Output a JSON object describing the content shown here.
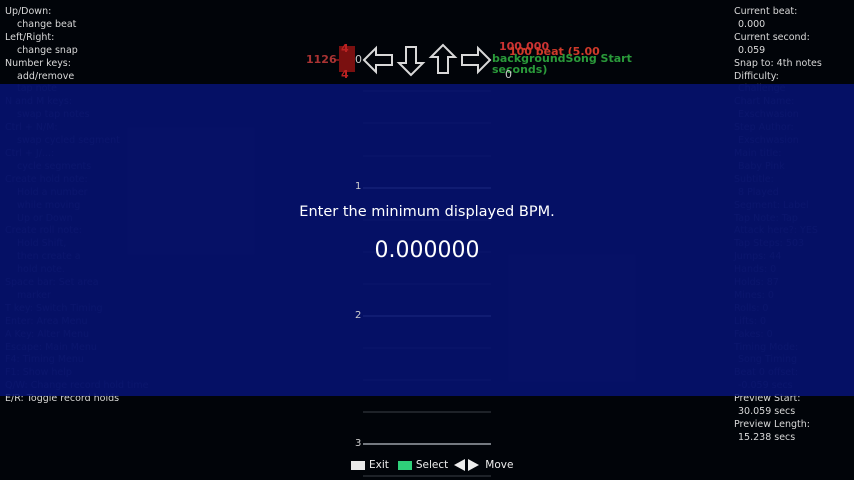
{
  "help_lines": [
    {
      "text": "Up/Down:",
      "indent": false,
      "dim": false
    },
    {
      "text": "change beat",
      "indent": true,
      "dim": false
    },
    {
      "text": "Left/Right:",
      "indent": false,
      "dim": false
    },
    {
      "text": "change snap",
      "indent": true,
      "dim": false
    },
    {
      "text": "Number keys:",
      "indent": false,
      "dim": false
    },
    {
      "text": "add/remove",
      "indent": true,
      "dim": false
    },
    {
      "text": "tap note",
      "indent": true,
      "dim": true
    },
    {
      "text": "N and M keys:",
      "indent": false,
      "dim": true
    },
    {
      "text": "swap tap notes",
      "indent": true,
      "dim": true
    },
    {
      "text": "Ctrl + N/M:",
      "indent": false,
      "dim": true
    },
    {
      "text": "swap cycled segment",
      "indent": true,
      "dim": true
    },
    {
      "text": "Ctrl + J/...:",
      "indent": false,
      "dim": true
    },
    {
      "text": "cycle segments",
      "indent": true,
      "dim": true
    },
    {
      "text": "Create hold note:",
      "indent": false,
      "dim": true
    },
    {
      "text": "Hold a number",
      "indent": true,
      "dim": true
    },
    {
      "text": "while moving",
      "indent": true,
      "dim": true
    },
    {
      "text": "Up or Down",
      "indent": true,
      "dim": true
    },
    {
      "text": "Create roll note:",
      "indent": false,
      "dim": true
    },
    {
      "text": "Hold Shift,",
      "indent": true,
      "dim": true
    },
    {
      "text": "then create a",
      "indent": true,
      "dim": true
    },
    {
      "text": "hold note.",
      "indent": true,
      "dim": true
    },
    {
      "text": "Space bar: Set area",
      "indent": false,
      "dim": true
    },
    {
      "text": "marker",
      "indent": true,
      "dim": true
    },
    {
      "text": "T key: Switch Timing",
      "indent": false,
      "dim": true
    },
    {
      "text": "Enter: Area Menu",
      "indent": false,
      "dim": true
    },
    {
      "text": "A Key: Alter Menu",
      "indent": false,
      "dim": true
    },
    {
      "text": "Escape: Main Menu",
      "indent": false,
      "dim": true
    },
    {
      "text": "F4: Timing Menu",
      "indent": false,
      "dim": true
    },
    {
      "text": "F1: Show help",
      "indent": false,
      "dim": true
    },
    {
      "text": "Q/W: Change record hold time",
      "indent": false,
      "dim": true
    },
    {
      "text": "E/R: Toggle record holds",
      "indent": false,
      "dim": false
    }
  ],
  "info_lines": [
    {
      "text": "Current beat:",
      "indent": false,
      "dim": false
    },
    {
      "text": "0.000",
      "indent": true,
      "dim": false
    },
    {
      "text": "Current second:",
      "indent": false,
      "dim": false
    },
    {
      "text": "0.059",
      "indent": true,
      "dim": false
    },
    {
      "text": "Snap to: 4th notes",
      "indent": false,
      "dim": false
    },
    {
      "text": "Difficulty:",
      "indent": false,
      "dim": false
    },
    {
      "text": "Challenge",
      "indent": true,
      "dim": true
    },
    {
      "text": "Chart Name:",
      "indent": false,
      "dim": true
    },
    {
      "text": "Exschwasion",
      "indent": true,
      "dim": true
    },
    {
      "text": "Step Author:",
      "indent": false,
      "dim": true
    },
    {
      "text": "Exschwasion",
      "indent": true,
      "dim": true
    },
    {
      "text": "Main title:",
      "indent": false,
      "dim": true
    },
    {
      "text": "Baby Pink",
      "indent": true,
      "dim": true
    },
    {
      "text": "Subtitle:",
      "indent": false,
      "dim": true
    },
    {
      "text": "8 Played",
      "indent": true,
      "dim": true
    },
    {
      "text": "Segment: Label",
      "indent": false,
      "dim": true
    },
    {
      "text": "Tap Note: Tap",
      "indent": false,
      "dim": true
    },
    {
      "text": "Attack here?: YES",
      "indent": false,
      "dim": true
    },
    {
      "text": "Tap Steps: 503",
      "indent": false,
      "dim": true
    },
    {
      "text": "Jumps: 44",
      "indent": false,
      "dim": true
    },
    {
      "text": "Hands: 0",
      "indent": false,
      "dim": true
    },
    {
      "text": "Holds: 87",
      "indent": false,
      "dim": true
    },
    {
      "text": "Mines: 0",
      "indent": false,
      "dim": true
    },
    {
      "text": "Rolls: 0",
      "indent": false,
      "dim": true
    },
    {
      "text": "Lifts: 0",
      "indent": false,
      "dim": true
    },
    {
      "text": "Fakes: 0",
      "indent": false,
      "dim": true
    },
    {
      "text": "Timing Mode:",
      "indent": false,
      "dim": true
    },
    {
      "text": "Song Timing",
      "indent": true,
      "dim": true
    },
    {
      "text": "Beat 0 offset:",
      "indent": false,
      "dim": true
    },
    {
      "text": "-0.059 secs",
      "indent": true,
      "dim": true
    },
    {
      "text": "Preview Start:",
      "indent": false,
      "dim": false
    },
    {
      "text": "30.059 secs",
      "indent": true,
      "dim": false
    },
    {
      "text": "Preview Length:",
      "indent": false,
      "dim": false
    },
    {
      "text": "15.238 secs",
      "indent": true,
      "dim": false
    }
  ],
  "receptor_arrows": [
    "left",
    "down",
    "up",
    "right"
  ],
  "receptor_icons": [
    "left-arrow-icon",
    "down-arrow-icon",
    "up-arrow-icon",
    "right-arrow-icon"
  ],
  "beat_labels": [
    "1",
    "2",
    "3"
  ],
  "snap_indicator": {
    "top": "4",
    "bottom": "4"
  },
  "row_number": "1126",
  "beat_zero": "0",
  "right_zero": "0",
  "segments": {
    "bpm": "100.000",
    "bpm_secondary": "100 beat (5.00",
    "stop": "backgroundSong Start seconds)",
    "song_start": "Song Start"
  },
  "dialog": {
    "prompt": "Enter the minimum displayed BPM.",
    "value": "0.000000"
  },
  "footer": {
    "exit_label": "Exit",
    "select_label": "Select",
    "move_label": "Move"
  },
  "colors": {
    "overlay": "#061270",
    "bpm_red": "#cc3333",
    "stop_green": "#2a9a3a",
    "select_key": "#2fd07a"
  }
}
